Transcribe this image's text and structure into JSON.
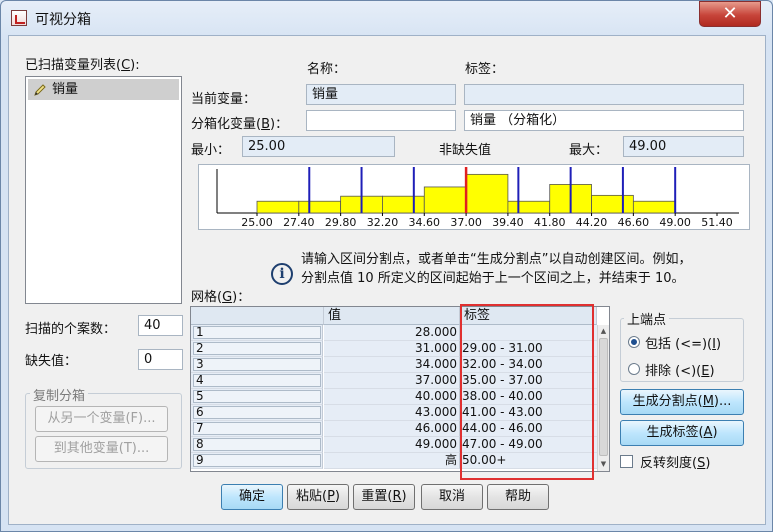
{
  "window": {
    "title": "可视分箱",
    "close_glyph": "✕"
  },
  "scanned_list": {
    "label": "已扫描变量列表(",
    "key": "C",
    "suffix": "):",
    "items": [
      "销量"
    ]
  },
  "header": {
    "name_label": "名称：",
    "tag_label": "标签："
  },
  "current_var": {
    "label": "当前变量：",
    "name": "销量",
    "tag": ""
  },
  "binned_var": {
    "label": "分箱化变量(",
    "key": "B",
    "suffix": ")：",
    "name": "",
    "tag": "销量 （分箱化）"
  },
  "stats": {
    "min_label": "最小：",
    "min": "25.00",
    "nonmissing_label": "非缺失值",
    "max_label": "最大：",
    "max": "49.00"
  },
  "histogram": {
    "axis_ticks": [
      "25.00",
      "27.40",
      "29.80",
      "32.20",
      "34.60",
      "37.00",
      "39.40",
      "41.80",
      "44.20",
      "46.60",
      "49.00",
      "51.40"
    ],
    "axis_min": 25.0,
    "axis_max": 51.4,
    "bars": [
      {
        "from": 25.0,
        "to": 27.4,
        "h": 0.28
      },
      {
        "from": 27.4,
        "to": 29.8,
        "h": 0.28
      },
      {
        "from": 29.8,
        "to": 32.2,
        "h": 0.4
      },
      {
        "from": 32.2,
        "to": 34.6,
        "h": 0.4
      },
      {
        "from": 34.6,
        "to": 37.0,
        "h": 0.62
      },
      {
        "from": 37.0,
        "to": 39.4,
        "h": 0.92
      },
      {
        "from": 39.4,
        "to": 41.8,
        "h": 0.28
      },
      {
        "from": 41.8,
        "to": 44.2,
        "h": 0.68
      },
      {
        "from": 44.2,
        "to": 46.6,
        "h": 0.42
      },
      {
        "from": 46.6,
        "to": 49.0,
        "h": 0.28
      }
    ],
    "cutpoints": [
      28,
      31,
      34,
      37,
      40,
      43,
      46,
      49
    ],
    "highlight_cutpoint": 37,
    "bar_color": "#ffff00",
    "cut_color": "#1f1fb8",
    "highlight_color": "#e02020"
  },
  "info": {
    "line1": "请输入区间分割点，或者单击“生成分割点”以自动创建区间。例如，",
    "line2": "分割点值 10 所定义的区间起始于上一个区间之上，并结束于 10。"
  },
  "grid": {
    "label": "网格(",
    "key": "G",
    "suffix": ")：",
    "col_value": "值",
    "col_tag": "标签",
    "rows": [
      {
        "n": "1",
        "value": "28.000",
        "tag": ""
      },
      {
        "n": "2",
        "value": "31.000",
        "tag": "29.00 - 31.00"
      },
      {
        "n": "3",
        "value": "34.000",
        "tag": "32.00 - 34.00"
      },
      {
        "n": "4",
        "value": "37.000",
        "tag": "35.00 - 37.00"
      },
      {
        "n": "5",
        "value": "40.000",
        "tag": "38.00 - 40.00"
      },
      {
        "n": "6",
        "value": "43.000",
        "tag": "41.00 - 43.00"
      },
      {
        "n": "7",
        "value": "46.000",
        "tag": "44.00 - 46.00"
      },
      {
        "n": "8",
        "value": "49.000",
        "tag": "47.00 - 49.00"
      },
      {
        "n": "9",
        "value": "高",
        "tag": "50.00+"
      }
    ]
  },
  "endpoint": {
    "title": "上端点",
    "include_label": "包括 (<=)(",
    "include_key": "I",
    "include_suffix": ")",
    "exclude_label": "排除 (<)(",
    "exclude_key": "E",
    "exclude_suffix": ")",
    "selected": "include"
  },
  "buttons": {
    "gen_cut_label": "生成分割点(",
    "gen_cut_key": "M",
    "gen_cut_suffix": ")...",
    "gen_tag_label": "生成标签(",
    "gen_tag_key": "A",
    "gen_tag_suffix": ")",
    "reverse_label": "反转刻度(",
    "reverse_key": "S",
    "reverse_suffix": ")",
    "ok": "确定",
    "paste_label": "粘贴(",
    "paste_key": "P",
    "paste_suffix": ")",
    "reset_label": "重置(",
    "reset_key": "R",
    "reset_suffix": ")",
    "cancel": "取消",
    "help": "帮助"
  },
  "cases": {
    "scanned_label": "扫描的个案数：",
    "scanned": "40",
    "missing_label": "缺失值：",
    "missing": "0"
  },
  "copy_bins": {
    "title": "复制分箱",
    "from_other": "从另一个变量(F)...",
    "to_other": "到其他变量(T)..."
  }
}
